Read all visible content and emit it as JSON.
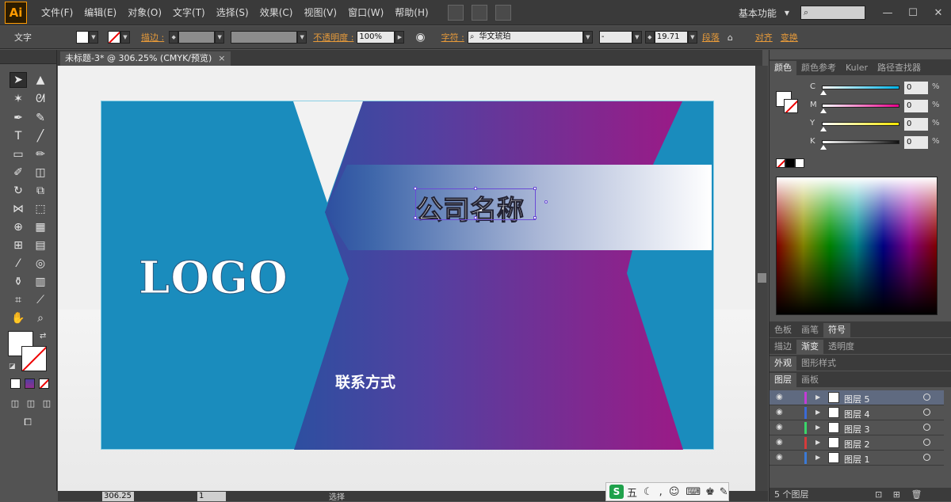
{
  "app": {
    "logo": "Ai"
  },
  "menu": [
    "文件(F)",
    "编辑(E)",
    "对象(O)",
    "文字(T)",
    "选择(S)",
    "效果(C)",
    "视图(V)",
    "窗口(W)",
    "帮助(H)"
  ],
  "workspace": "基本功能",
  "window_buttons": [
    "—",
    "☐",
    "✕"
  ],
  "control_bar": {
    "mode_label": "文字",
    "stroke_label": "描边 :",
    "opacity_label": "不透明度 :",
    "opacity_value": "100%",
    "char_label": "字符 :",
    "font_name": "华文琥珀",
    "font_style": "-",
    "font_size": "19.71",
    "paragraph_label": "段落",
    "align_label": "对齐",
    "transform_label": "变换"
  },
  "document_tab": {
    "title": "未标题-3* @ 306.25% (CMYK/预览)",
    "close": "×"
  },
  "artboard": {
    "logo_text": "LOGO",
    "company_name": "公司名称",
    "contact": "联系方式",
    "colors": {
      "card_blue": "#1a8cbd",
      "grad_start": "#2d4fa0",
      "grad_end": "#9b1a86"
    }
  },
  "status_bar": {
    "zoom": "306.25",
    "page": "1",
    "status": "选择"
  },
  "ime": {
    "mode": "五"
  },
  "color_panel": {
    "tabs": [
      "颜色",
      "颜色参考",
      "Kuler",
      "路径查找器"
    ],
    "channels": [
      {
        "name": "C",
        "value": "0",
        "unit": "%",
        "color": "#00b3e6"
      },
      {
        "name": "M",
        "value": "0",
        "unit": "%",
        "color": "#e6008a"
      },
      {
        "name": "Y",
        "value": "0",
        "unit": "%",
        "color": "#f5e600"
      },
      {
        "name": "K",
        "value": "0",
        "unit": "%",
        "color": "#222222"
      }
    ]
  },
  "panel_tabs_a": [
    "色板",
    "画笔",
    "符号"
  ],
  "panel_tabs_b": [
    "描边",
    "渐变",
    "透明度"
  ],
  "panel_tabs_c": [
    "外观",
    "图形样式"
  ],
  "panel_tabs_d": [
    "图层",
    "画板"
  ],
  "layers": [
    {
      "name": "图层 5",
      "color": "#c33bd6",
      "selected": true
    },
    {
      "name": "图层 4",
      "color": "#3b6ad6",
      "selected": false
    },
    {
      "name": "图层 3",
      "color": "#3bd66a",
      "selected": false
    },
    {
      "name": "图层 2",
      "color": "#d63b3b",
      "selected": false
    },
    {
      "name": "图层 1",
      "color": "#3b7ad6",
      "selected": false
    }
  ],
  "layers_footer": "5 个图层"
}
